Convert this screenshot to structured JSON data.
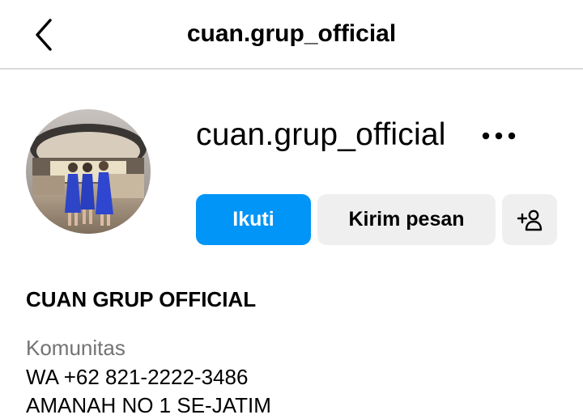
{
  "header": {
    "title": "cuan.grup_official",
    "back_icon": "chevron-left-icon"
  },
  "profile": {
    "username": "cuan.grup_official",
    "more_icon": "more-horizontal-icon",
    "avatar_icon": "profile-photo"
  },
  "actions": {
    "follow_label": "Ikuti",
    "message_label": "Kirim pesan",
    "add_user_icon": "add-user-icon",
    "follow_color": "#0095f6",
    "secondary_color": "#efefef"
  },
  "bio": {
    "display_name": "CUAN GRUP OFFICIAL",
    "category": "Komunitas",
    "lines": [
      "WA +62 821-2222-3486",
      "AMANAH NO 1 SE-JATIM"
    ]
  }
}
